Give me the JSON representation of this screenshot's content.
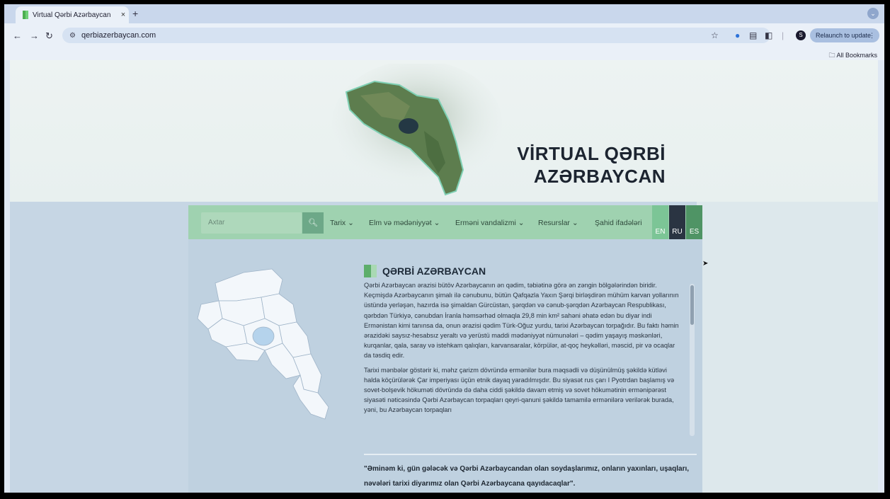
{
  "browser": {
    "tab_title": "Virtual Qərbi Azərbaycan",
    "tab_close": "×",
    "new_tab": "+",
    "url": "qerbiazerbaycan.com",
    "avatar_letter": "S",
    "relaunch_label": "Relaunch to update",
    "bookmarks_label": "All Bookmarks"
  },
  "hero": {
    "title_line1": "VİRTUAL QƏRBİ",
    "title_line2": "AZƏRBAYCAN"
  },
  "nav": {
    "search_placeholder": "Axtar",
    "items": [
      {
        "label": "Tarix ⌄"
      },
      {
        "label": "Elm və mədəniyyət ⌄"
      },
      {
        "label": "Erməni vandalizmi ⌄"
      },
      {
        "label": "Resurslar ⌄"
      },
      {
        "label": "Şahid ifadələri"
      }
    ],
    "languages": [
      {
        "code": "EN",
        "color": "#7cc596"
      },
      {
        "code": "RU",
        "color": "#2a3442"
      },
      {
        "code": "ES",
        "color": "#4f9465"
      }
    ]
  },
  "section": {
    "title": "QƏRBİ AZƏRBAYCAN",
    "paragraph1": "Qərbi Azərbaycan ərazisi bütöv Azərbaycanın ən qədim, təbiətinə görə ən zəngin bölgələrindən biridir. Keçmişdə Azərbaycanın şimalı ilə cənubunu, bütün Qafqazla Yaxın Şərqi birləşdirən mühüm karvan yollarının üstündə yerləşən, hazırda isə şimaldan Gürcüstan, şərqdən və cənub-şərqdən Azərbaycan Respublikası, qərbdən Türkiyə, cənubdan İranla həmsərhəd olmaqla 29,8 min km² sahəni əhatə edən bu diyar indi Ermənistan kimi tanınsa da, onun ərazisi qədim Türk-Oğuz yurdu, tarixi Azərbaycan torpağıdır. Bu faktı həmin ərazidəki saysız-hesabsız yeraltı və yerüstü maddi mədəniyyət nümunələri – qədim yaşayış məskənləri, kurqanlar, qala, saray və istehkam qalıqları, karvansaralar, körpülər, at-qoç heykəlləri, məscid, pir və ocaqlar da təsdiq edir.",
    "paragraph2": "Tarixi mənbələr göstərir ki, məhz çarizm dövründə ermənilər bura məqsədli və düşünülmüş şəkildə kütləvi halda köçürülərək Çar imperiyası üçün etnik dayaq yaradılmışdır. Bu siyasət rus çarı I Pyotrdan başlamış və sovet-bolşevik hökuməti dövründə də daha ciddi şəkildə davam etmiş və sovet hökumətinin ermənipərəst siyasəti nəticəsində Qərbi Azərbaycan torpaqları qeyri-qanuni şəkildə tamamilə ermənilərə verilərək burada, yəni, bu Azərbaycan torpaqları",
    "quote": "\"Əminəm ki, gün gələcək və Qərbi Azərbaycandan olan soydaşlarımız, onların yaxınları, uşaqları, nəvələri tarixi diyarımız olan Qərbi Azərbaycana qayıdacaqlar\"."
  }
}
